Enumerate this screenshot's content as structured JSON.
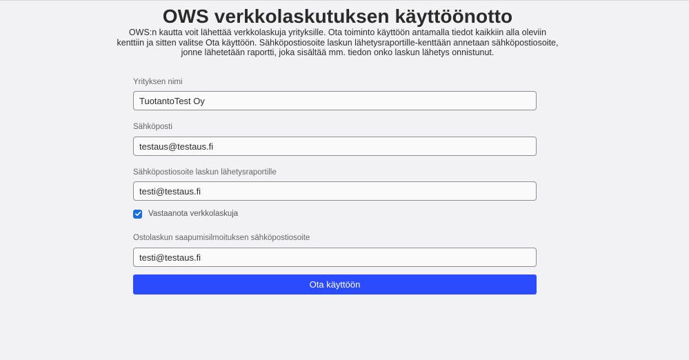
{
  "page": {
    "title": "OWS verkkolaskutuksen käyttöönotto",
    "intro": "OWS:n kautta voit lähettää verkkolaskuja yrityksille. Ota toiminto käyttöön antamalla tiedot kaikkiin alla oleviin kenttiin ja sitten valitse Ota käyttöön. Sähköpostiosoite laskun lähetysraportille-kenttään annetaan sähköpostiosoite, jonne lähetetään raportti, joka sisältää mm. tiedon onko laskun lähetys onnistunut."
  },
  "form": {
    "company_name": {
      "label": "Yrityksen nimi",
      "value": "TuotantoTest Oy"
    },
    "email": {
      "label": "Sähköposti",
      "value": "testaus@testaus.fi"
    },
    "report_email": {
      "label": "Sähköpostiosoite laskun lähetysraportille",
      "value": "testi@testaus.fi"
    },
    "receive_einvoices": {
      "label": "Vastaanota verkkolaskuja",
      "checked": true
    },
    "purchase_notification_email": {
      "label": "Ostolaskun saapumisilmoituksen sähköpostiosoite",
      "value": "testi@testaus.fi"
    },
    "submit_label": "Ota käyttöön"
  },
  "colors": {
    "background": "#f2f2f4",
    "button": "#2a4bff",
    "checkbox": "#1a6fd8"
  }
}
